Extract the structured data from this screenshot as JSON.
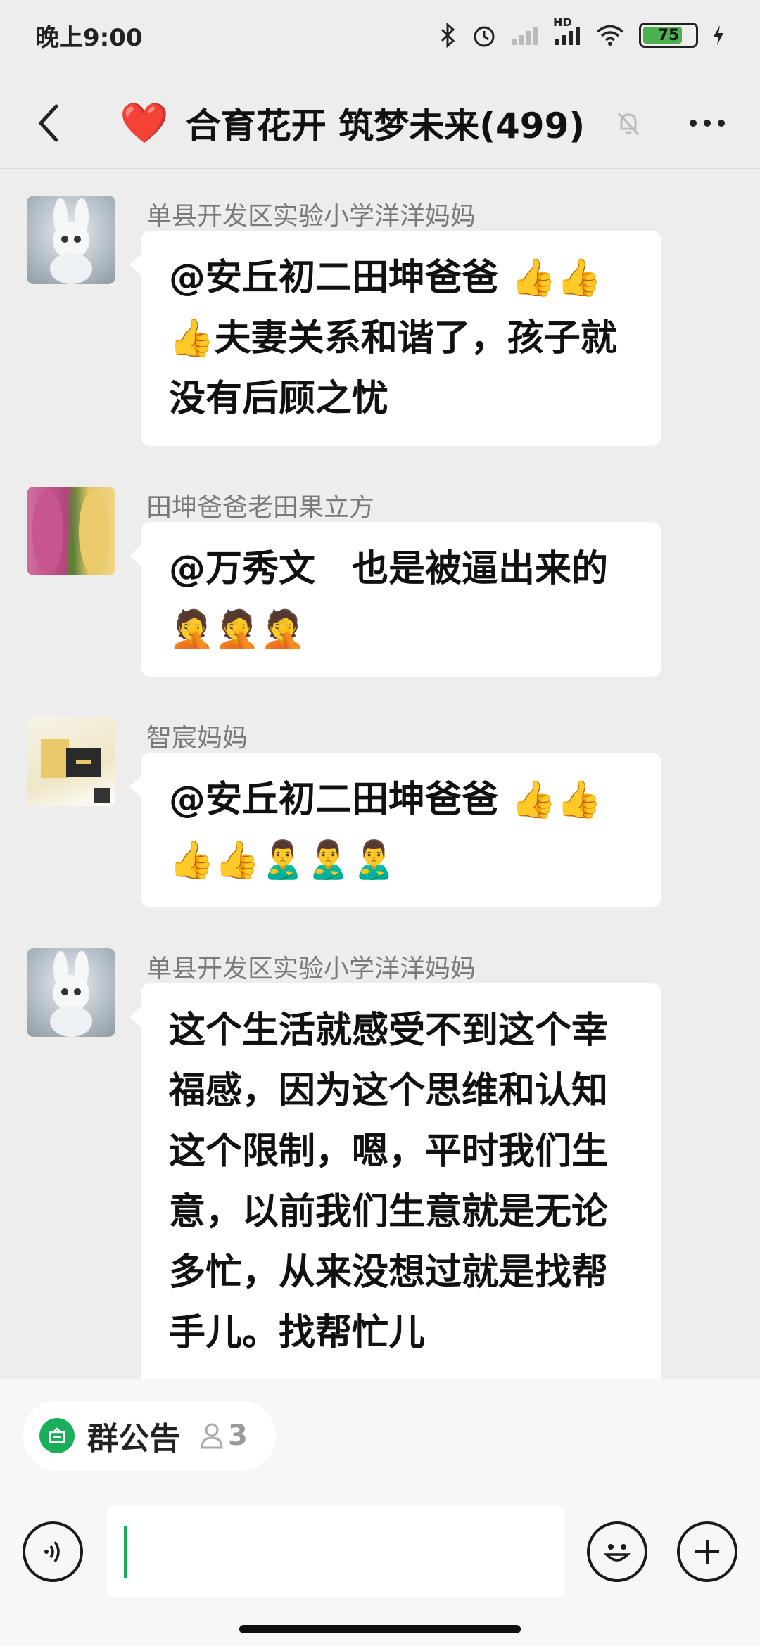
{
  "status_bar": {
    "time": "晚上9:00",
    "icons": [
      "bluetooth-icon",
      "alarm-icon",
      "signal-icon",
      "hd-signal-icon",
      "wifi-icon",
      "battery-icon",
      "charging-icon"
    ],
    "battery_level": "75",
    "hd_label": "HD"
  },
  "header": {
    "back_icon": "chevron-left-icon",
    "title_icon": "❤️",
    "title": "合育花开 筑梦未来(499)",
    "mute_icon": "bell-muted-icon",
    "more_icon": "more-dots-icon"
  },
  "messages": [
    {
      "sender": "单县开发区实验小学洋洋妈妈",
      "avatar": "rabbit-avatar",
      "text": "@安丘初二田坤爸爸 👍👍👍夫妻关系和谐了，孩子就没有后顾之忧"
    },
    {
      "sender": "田坤爸爸老田果立方",
      "avatar": "corn-avatar",
      "text": "@万秀文　也是被逼出来的🤦🤦🤦"
    },
    {
      "sender": "智宸妈妈",
      "avatar": "product-avatar",
      "text": "@安丘初二田坤爸爸 👍👍👍👍🙎‍♂️🙎‍♂️🙎‍♂️"
    },
    {
      "sender": "单县开发区实验小学洋洋妈妈",
      "avatar": "rabbit-avatar",
      "text": "这个生活就感受不到这个幸福感，因为这个思维和认知这个限制，嗯，平时我们生意，以前我们生意就是无论多忙，从来没想过就是找帮手儿。找帮忙儿"
    }
  ],
  "announcement": {
    "label": "群公告",
    "count": "3"
  },
  "input_bar": {
    "voice_icon": "voice-icon",
    "emoji_icon": "emoji-icon",
    "plus_icon": "plus-icon",
    "value": ""
  },
  "colors": {
    "background": "#ededed",
    "bubble": "#ffffff",
    "accent_green": "#1aad5a",
    "heart_red": "#e53935"
  }
}
